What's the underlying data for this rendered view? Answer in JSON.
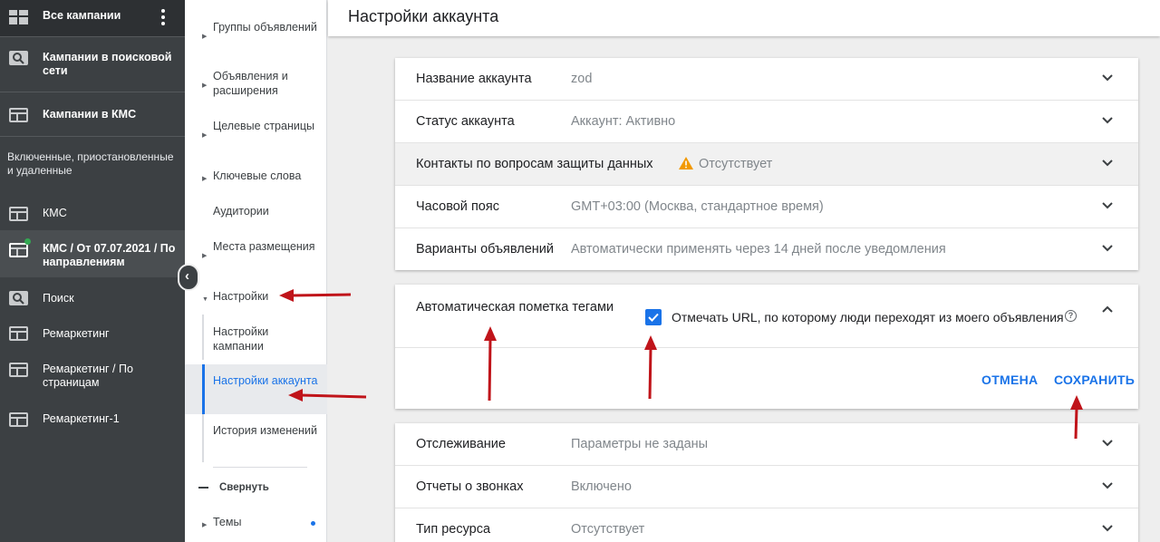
{
  "sidebar": {
    "items": [
      {
        "label": "Все кампании",
        "icon": "grid-icon"
      },
      {
        "label": "Кампании в поисковой сети",
        "icon": "search-icon"
      },
      {
        "label": "Кампании в КМС",
        "icon": "display-icon"
      },
      {
        "label": "КМС",
        "icon": "display-icon"
      },
      {
        "label": "КМС / От 07.07.2021 / По направлениям",
        "icon": "display-icon"
      },
      {
        "label": "Поиск",
        "icon": "search-icon"
      },
      {
        "label": "Ремаркетинг",
        "icon": "display-icon"
      },
      {
        "label": "Ремаркетинг / По страницам",
        "icon": "display-icon"
      },
      {
        "label": "Ремаркетинг-1",
        "icon": "display-icon"
      }
    ],
    "section_label": "Включенные, приостановленные и удаленные"
  },
  "nav": {
    "items": [
      {
        "label": "Группы объявлений"
      },
      {
        "label": "Объявления и расширения"
      },
      {
        "label": "Целевые страницы"
      },
      {
        "label": "Ключевые слова"
      },
      {
        "label": "Аудитории"
      },
      {
        "label": "Места размещения"
      },
      {
        "label": "Настройки"
      },
      {
        "label": "Настройки кампании"
      },
      {
        "label": "Настройки аккаунта"
      },
      {
        "label": "История изменений"
      },
      {
        "label": "Темы"
      }
    ],
    "collapse_label": "Свернуть"
  },
  "header": {
    "title": "Настройки аккаунта"
  },
  "settings_top": [
    {
      "key": "Название аккаунта",
      "value": "zod"
    },
    {
      "key": "Статус аккаунта",
      "value": "Аккаунт: Активно"
    },
    {
      "key": "Контакты по вопросам защиты данных",
      "value": "Отсутствует"
    },
    {
      "key": "Часовой пояс",
      "value": "GMT+03:00 (Москва, стандартное время)"
    },
    {
      "key": "Варианты объявлений",
      "value": "Автоматически применять через 14 дней после уведомления"
    }
  ],
  "auto_tagging": {
    "title": "Автоматическая пометка тегами",
    "checkbox_label": "Отмечать URL, по которому люди переходят из моего объявления",
    "help": "?",
    "cancel": "ОТМЕНА",
    "save": "СОХРАНИТЬ"
  },
  "settings_bottom": [
    {
      "key": "Отслеживание",
      "value": "Параметры не заданы"
    },
    {
      "key": "Отчеты о звонках",
      "value": "Включено"
    },
    {
      "key": "Тип ресурса",
      "value": "Отсутствует"
    }
  ],
  "colors": {
    "accent": "#1a73e8",
    "sidebar_bg": "#3c4043",
    "warning": "#f29900",
    "annotation": "#c0141a"
  }
}
